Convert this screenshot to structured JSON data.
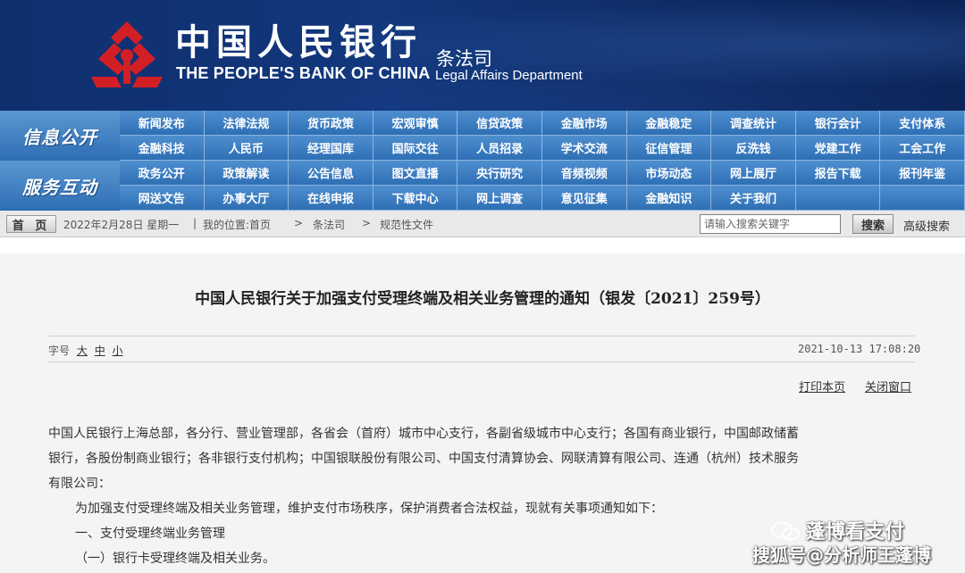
{
  "header": {
    "bank_name_cn": "中国人民银行",
    "bank_name_en": "THE PEOPLE'S BANK OF CHINA",
    "dept_cn": "条法司",
    "dept_en": "Legal Affairs Department",
    "emblem_color": "#d21f26",
    "banner_color": "#12377c"
  },
  "nav": {
    "info_title": "信息公开",
    "info_items": [
      "新闻发布",
      "法律法规",
      "货币政策",
      "宏观审慎",
      "信贷政策",
      "金融市场",
      "金融稳定",
      "调查统计",
      "银行会计",
      "支付体系",
      "金融科技",
      "人民币",
      "经理国库",
      "国际交往",
      "人员招录",
      "学术交流",
      "征信管理",
      "反洗钱",
      "党建工作",
      "工会工作"
    ],
    "service_title": "服务互动",
    "service_items": [
      "政务公开",
      "政策解读",
      "公告信息",
      "图文直播",
      "央行研究",
      "音频视频",
      "市场动态",
      "网上展厅",
      "报告下载",
      "报刊年鉴",
      "网送文告",
      "办事大厅",
      "在线申报",
      "下载中心",
      "网上调查",
      "意见征集",
      "金融知识",
      "关于我们"
    ]
  },
  "crumbs": {
    "home": "首 页",
    "date": "2022年2月28日  星期一",
    "location_label": "我的位置:首页",
    "level2": "条法司",
    "level3": "规范性文件",
    "separator": ">",
    "divider": "|"
  },
  "search": {
    "placeholder": "请输入搜索关键字",
    "button": "搜索",
    "advanced": "高级搜索"
  },
  "article": {
    "title": "中国人民银行关于加强支付受理终端及相关业务管理的通知（银发〔2021〕259号）",
    "font_size_label": "字号",
    "font_large": "大",
    "font_medium": "中",
    "font_small": "小",
    "published": "2021-10-13 17:08:20",
    "print": "打印本页",
    "close": "关闭窗口",
    "lines": [
      "中国人民银行上海总部，各分行、营业管理部，各省会（首府）城市中心支行，各副省级城市中心支行；各国有商业银行，中国邮政储蓄",
      "银行，各股份制商业银行；各非银行支付机构；中国银联股份有限公司、中国支付清算协会、网联清算有限公司、连通（杭州）技术服务",
      "有限公司：",
      "为加强支付受理终端及相关业务管理，维护支付市场秩序，保护消费者合法权益，现就有关事项通知如下：",
      "一、支付受理终端业务管理",
      "（一）银行卡受理终端及相关业务。"
    ]
  },
  "watermark": {
    "line1": "蓬博看支付",
    "line2": "搜狐号@分析师王蓬博"
  }
}
